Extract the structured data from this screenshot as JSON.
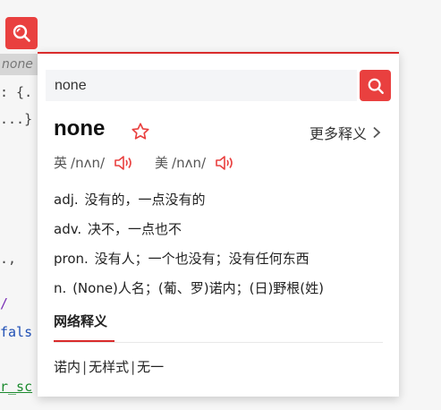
{
  "background": {
    "selected_word": "none",
    "code_lines": [
      {
        "text": ": {.",
        "color": "#444"
      },
      {
        "text": "...}",
        "color": "#444"
      },
      {
        "text": ".,",
        "color": "#444"
      },
      {
        "text": "/",
        "color": "#7a2fb5"
      },
      {
        "text": "fals",
        "color": "#1f4fb5"
      },
      {
        "text": "r_sc",
        "color": "#1b8a2e"
      }
    ]
  },
  "trigger": {
    "icon": "search-icon"
  },
  "popup": {
    "search": {
      "value": "none",
      "icon": "search-icon"
    },
    "word": "none",
    "favorite_icon": "star-outline-icon",
    "more_label": "更多释义",
    "phonetics": [
      {
        "label": "英",
        "ipa": "/nʌn/"
      },
      {
        "label": "美",
        "ipa": "/nʌn/"
      }
    ],
    "definitions": [
      {
        "pos": "adj.",
        "text": "没有的，一点没有的"
      },
      {
        "pos": "adv.",
        "text": "决不，一点也不"
      },
      {
        "pos": "pron.",
        "text": "没有人；一个也没有；没有任何东西"
      },
      {
        "pos": "n.",
        "text": "(None)人名；(葡、罗)诺内；(日)野根(姓)"
      }
    ],
    "web_title": "网络释义",
    "web_items": [
      "诺内",
      "无样式",
      "无一"
    ],
    "accent": "#e9403f"
  }
}
